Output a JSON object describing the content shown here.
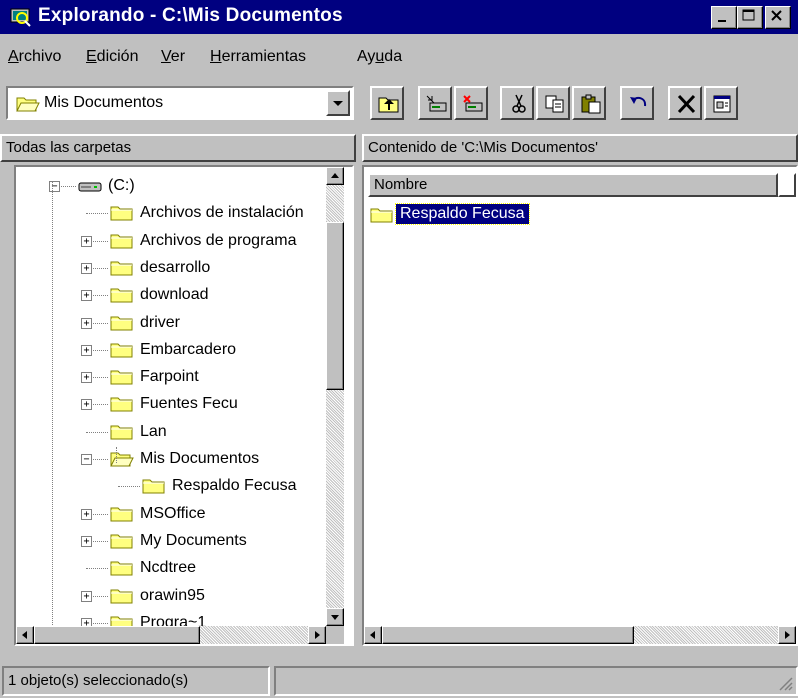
{
  "window": {
    "title": "Explorando - C:\\Mis Documentos",
    "title_icon": "explorer-icon"
  },
  "menu": {
    "items": [
      "Archivo",
      "Edición",
      "Ver",
      "Herramientas",
      "Ayuda"
    ],
    "accel_index": [
      0,
      0,
      0,
      0,
      2
    ]
  },
  "toolbar": {
    "address_value": "Mis Documentos",
    "buttons": [
      "up-folder-icon",
      "map-drive-icon",
      "disconnect-drive-icon",
      "cut-icon",
      "copy-icon",
      "paste-icon",
      "undo-icon",
      "delete-icon",
      "properties-icon"
    ]
  },
  "left_panel": {
    "header": "Todas las carpetas",
    "tree": [
      {
        "label": "(C:)",
        "icon": "drive-icon",
        "expander": "minus"
      },
      {
        "label": "Archivos de instalación",
        "icon": "folder-icon",
        "expander": "none"
      },
      {
        "label": "Archivos de programa",
        "icon": "folder-icon",
        "expander": "plus"
      },
      {
        "label": "desarrollo",
        "icon": "folder-icon",
        "expander": "plus"
      },
      {
        "label": "download",
        "icon": "folder-icon",
        "expander": "plus"
      },
      {
        "label": "driver",
        "icon": "folder-icon",
        "expander": "plus"
      },
      {
        "label": "Embarcadero",
        "icon": "folder-icon",
        "expander": "plus"
      },
      {
        "label": "Farpoint",
        "icon": "folder-icon",
        "expander": "plus"
      },
      {
        "label": "Fuentes Fecu",
        "icon": "folder-icon",
        "expander": "plus"
      },
      {
        "label": "Lan",
        "icon": "folder-icon",
        "expander": "none"
      },
      {
        "label": "Mis Documentos",
        "icon": "open-folder-icon",
        "expander": "minus"
      },
      {
        "label": "Respaldo Fecusa",
        "icon": "folder-icon",
        "expander": "none"
      },
      {
        "label": "MSOffice",
        "icon": "folder-icon",
        "expander": "plus"
      },
      {
        "label": "My Documents",
        "icon": "folder-icon",
        "expander": "plus"
      },
      {
        "label": "Ncdtree",
        "icon": "folder-icon",
        "expander": "none"
      },
      {
        "label": "orawin95",
        "icon": "folder-icon",
        "expander": "plus"
      },
      {
        "label": "Progra~1",
        "icon": "folder-icon",
        "expander": "plus"
      }
    ]
  },
  "right_panel": {
    "header": "Contenido de 'C:\\Mis Documentos'",
    "column": "Nombre",
    "items": [
      {
        "label": "Respaldo Fecusa",
        "icon": "folder-icon",
        "selected": true
      }
    ]
  },
  "status": {
    "text": "1 objeto(s) seleccionado(s)"
  },
  "colors": {
    "titlebar": "#000080",
    "face": "#c0c0c0",
    "selection": "#000080",
    "folder": "#ffff80"
  }
}
